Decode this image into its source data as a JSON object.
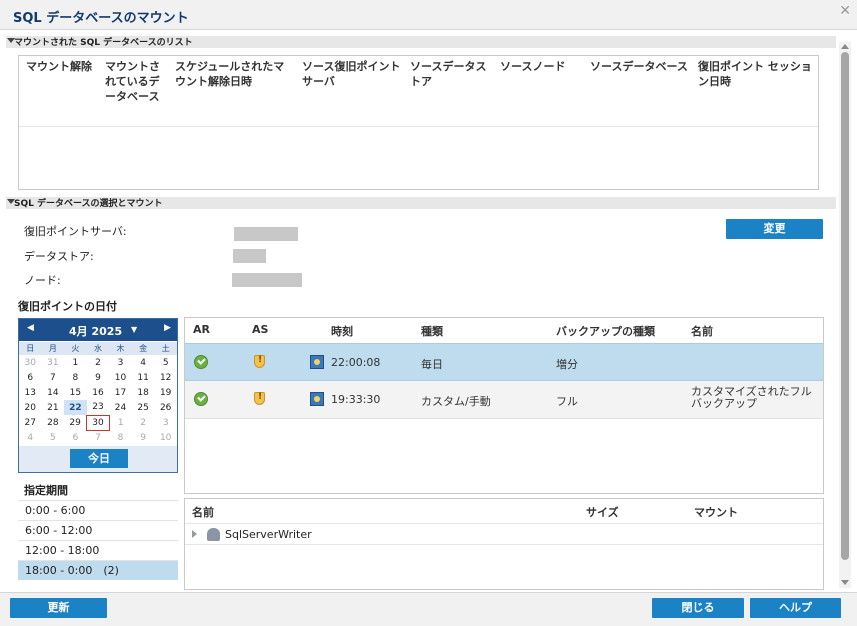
{
  "window": {
    "title": "SQL データベースのマウント"
  },
  "mounted_section": {
    "title": "マウントされた SQL データベースのリスト",
    "columns": [
      "マウント解除",
      "マウントされているデータベース",
      "スケジュールされたマウント解除日時",
      "ソース復旧ポイントサーバ",
      "ソースデータストア",
      "ソースノード",
      "ソースデータベース",
      "復旧ポイント セッション日時"
    ]
  },
  "select_section": {
    "title": "SQL データベースの選択とマウント",
    "rps_label": "復旧ポイントサーバ:",
    "datastore_label": "データストア:",
    "node_label": "ノード:",
    "change_button": "変更"
  },
  "recovery_date": {
    "title": "復旧ポイントの日付",
    "calendar": {
      "month_label": "4月 2025",
      "days_of_week": [
        "日",
        "月",
        "火",
        "水",
        "木",
        "金",
        "土"
      ],
      "weeks": [
        [
          "30",
          "31",
          "1",
          "2",
          "3",
          "4",
          "5"
        ],
        [
          "6",
          "7",
          "8",
          "9",
          "10",
          "11",
          "12"
        ],
        [
          "13",
          "14",
          "15",
          "16",
          "17",
          "18",
          "19"
        ],
        [
          "20",
          "21",
          "22",
          "23",
          "24",
          "25",
          "26"
        ],
        [
          "27",
          "28",
          "29",
          "30",
          "1",
          "2",
          "3"
        ],
        [
          "4",
          "5",
          "6",
          "7",
          "8",
          "9",
          "10"
        ]
      ],
      "selected_day": "22",
      "today_day": "30",
      "today_button": "今日"
    }
  },
  "period": {
    "title": "指定期間",
    "items": [
      "0:00 - 6:00",
      "6:00 - 12:00",
      "12:00 - 18:00",
      "18:00 - 0:00　(2)"
    ],
    "active_index": 3
  },
  "recovery_points": {
    "columns": [
      "AR",
      "AS",
      "時刻",
      "種類",
      "バックアップの種類",
      "名前"
    ],
    "rows": [
      {
        "time": "22:00:08",
        "type": "毎日",
        "backup_type": "増分",
        "name": ""
      },
      {
        "time": "19:33:30",
        "type": "カスタム/手動",
        "backup_type": "フル",
        "name": "カスタマイズされたフル バックアップ"
      }
    ]
  },
  "writers": {
    "columns": [
      "名前",
      "サイズ",
      "マウント"
    ],
    "rows": [
      {
        "name": "SqlServerWriter"
      }
    ]
  },
  "footer": {
    "refresh": "更新",
    "close": "閉じる",
    "help": "ヘルプ"
  },
  "colors": {
    "accent": "#1c82c6",
    "title_text": "#123a6b",
    "selection": "#bfdcef",
    "calendar_header": "#1d4f8c"
  }
}
